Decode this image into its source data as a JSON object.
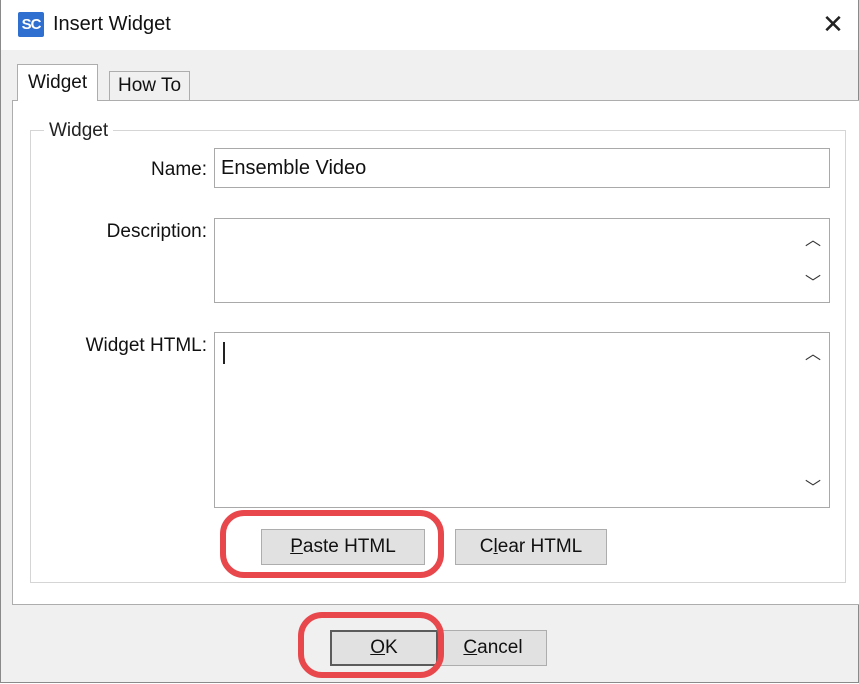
{
  "window": {
    "title": "Insert Widget",
    "icon_text": "SC"
  },
  "tabs": [
    {
      "label": "Widget",
      "active": true
    },
    {
      "label": "How To",
      "active": false
    }
  ],
  "group": {
    "label": "Widget",
    "name_label": "Name:",
    "name_value": "Ensemble Video",
    "description_label": "Description:",
    "description_value": "",
    "html_label": "Widget HTML:",
    "html_value": ""
  },
  "buttons": {
    "paste_html": {
      "mnemonic": "P",
      "rest": "aste HTML"
    },
    "clear_html": {
      "prefix": "C",
      "mnemonic": "l",
      "rest": "ear HTML"
    },
    "ok": {
      "mnemonic": "O",
      "rest": "K"
    },
    "cancel": {
      "mnemonic": "C",
      "rest": "ancel"
    }
  },
  "icons": {
    "close": "close-icon",
    "scroll_up": "chevron-up-icon",
    "scroll_down": "chevron-down-icon"
  },
  "colors": {
    "highlight": "#e8474c",
    "app_icon": "#2f6fd0"
  }
}
